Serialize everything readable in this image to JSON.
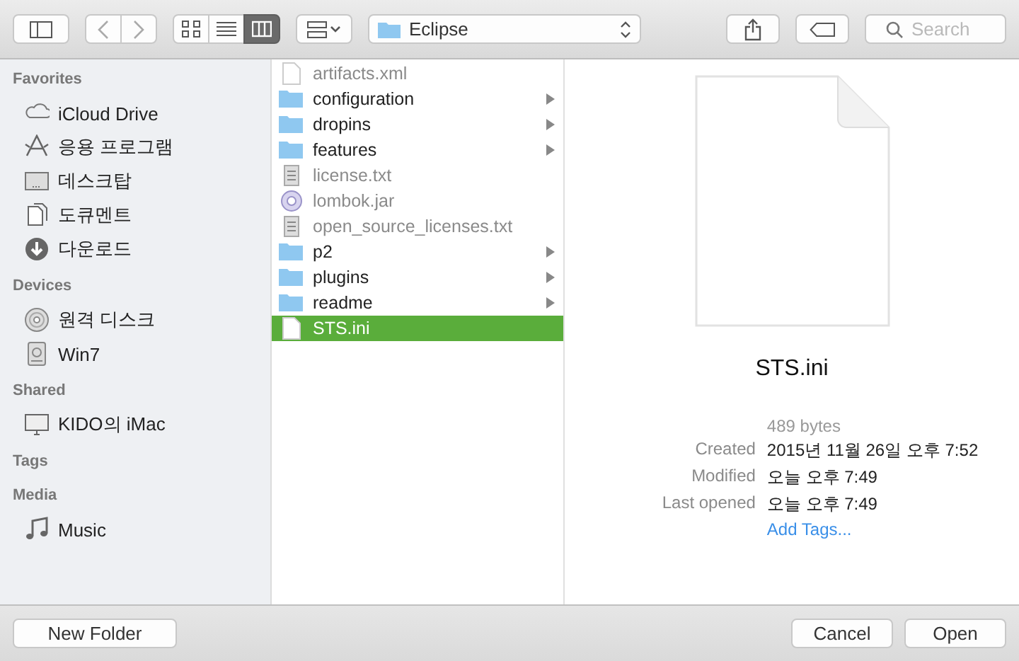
{
  "toolbar": {
    "view_modes": [
      {
        "kind": "icons",
        "selected": false
      },
      {
        "kind": "list",
        "selected": false
      },
      {
        "kind": "columns",
        "selected": true
      }
    ],
    "location": "Eclipse",
    "search": {
      "placeholder": "Search"
    }
  },
  "sidebar": {
    "sections": [
      {
        "title": "Favorites",
        "items": [
          {
            "kind": "cloud",
            "label": "iCloud Drive"
          },
          {
            "kind": "apps",
            "label": "응용 프로그램"
          },
          {
            "kind": "desktop",
            "label": "데스크탑"
          },
          {
            "kind": "documents",
            "label": "도큐멘트"
          },
          {
            "kind": "download",
            "label": "다운로드"
          }
        ]
      },
      {
        "title": "Devices",
        "items": [
          {
            "kind": "disc",
            "label": "원격 디스크"
          },
          {
            "kind": "drive",
            "label": "Win7"
          }
        ]
      },
      {
        "title": "Shared",
        "items": [
          {
            "kind": "monitor",
            "label": "KIDO의 iMac"
          }
        ]
      },
      {
        "title": "Tags"
      },
      {
        "title": "Media",
        "items": [
          {
            "kind": "music",
            "label": "Music"
          }
        ]
      }
    ]
  },
  "files": [
    {
      "kind": "file",
      "name": "artifacts.xml",
      "disabled": true,
      "selected": false
    },
    {
      "kind": "folder",
      "name": "configuration",
      "disabled": false,
      "selected": false
    },
    {
      "kind": "folder",
      "name": "dropins",
      "disabled": false,
      "selected": false
    },
    {
      "kind": "folder",
      "name": "features",
      "disabled": false,
      "selected": false
    },
    {
      "kind": "text",
      "name": "license.txt",
      "disabled": true,
      "selected": false
    },
    {
      "kind": "jar",
      "name": "lombok.jar",
      "disabled": true,
      "selected": false
    },
    {
      "kind": "text",
      "name": "open_source_licenses.txt",
      "disabled": true,
      "selected": false
    },
    {
      "kind": "folder",
      "name": "p2",
      "disabled": false,
      "selected": false
    },
    {
      "kind": "folder",
      "name": "plugins",
      "disabled": false,
      "selected": false
    },
    {
      "kind": "folder",
      "name": "readme",
      "disabled": false,
      "selected": false
    },
    {
      "kind": "file",
      "name": "STS.ini",
      "disabled": false,
      "selected": true
    }
  ],
  "preview": {
    "name": "STS.ini",
    "size": "489 bytes",
    "details": [
      {
        "label": "Created",
        "value": "2015년 11월 26일 오후 7:52"
      },
      {
        "label": "Modified",
        "value": "오늘 오후 7:49"
      },
      {
        "label": "Last opened",
        "value": "오늘 오후 7:49"
      }
    ],
    "add_tags": "Add Tags..."
  },
  "buttons": {
    "new_folder": "New Folder",
    "cancel": "Cancel",
    "open": "Open"
  }
}
